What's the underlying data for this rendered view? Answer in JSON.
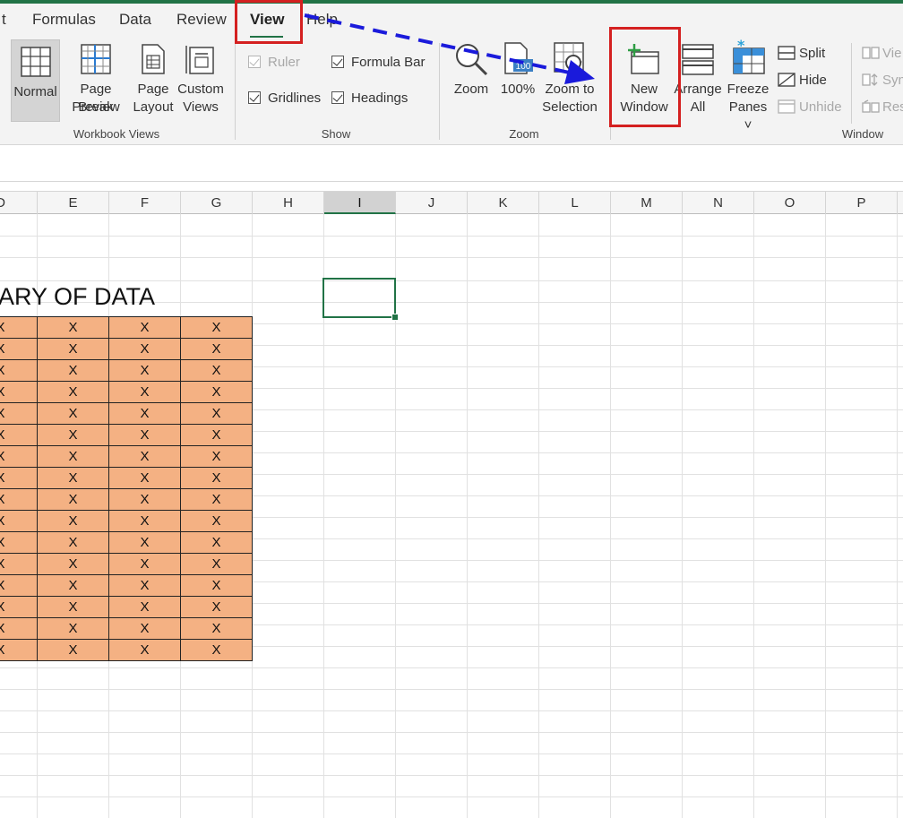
{
  "tabs": [
    {
      "label": "t"
    },
    {
      "label": "Formulas"
    },
    {
      "label": "Data"
    },
    {
      "label": "Review"
    },
    {
      "label": "View"
    },
    {
      "label": "Help"
    }
  ],
  "ribbon": {
    "workbook_views": {
      "group_label": "Workbook Views",
      "normal": [
        "Normal",
        ""
      ],
      "page_break": [
        "Page Break",
        "Preview"
      ],
      "page_layout": [
        "Page",
        "Layout"
      ],
      "custom_views": [
        "Custom",
        "Views"
      ]
    },
    "show": {
      "group_label": "Show",
      "ruler": "Ruler",
      "formula_bar": "Formula Bar",
      "gridlines": "Gridlines",
      "headings": "Headings"
    },
    "zoom": {
      "group_label": "Zoom",
      "zoom": "Zoom",
      "hundred": "100%",
      "hundred_icon_text": "100",
      "zoom_sel": [
        "Zoom to",
        "Selection"
      ]
    },
    "window": {
      "group_label": "Window",
      "new_window": [
        "New",
        "Window"
      ],
      "arrange_all": [
        "Arrange",
        "All"
      ],
      "freeze_panes": [
        "Freeze",
        "Panes ˅"
      ],
      "split": "Split",
      "hide": "Hide",
      "unhide": "Unhide",
      "view_side": "Vie",
      "sync": "Syn",
      "reset": "Res"
    }
  },
  "columns": [
    "D",
    "E",
    "F",
    "G",
    "H",
    "I",
    "J",
    "K",
    "L",
    "M",
    "N",
    "O",
    "P"
  ],
  "selected_column": "I",
  "sheet": {
    "title": "ARY OF DATA",
    "cell_mark": "X",
    "rows": [
      [
        "X",
        "X",
        "X",
        "X"
      ],
      [
        "X",
        "X",
        "X",
        "X"
      ],
      [
        "X",
        "X",
        "X",
        "X"
      ],
      [
        "X",
        "X",
        "X",
        "X"
      ],
      [
        "X",
        "X",
        "X",
        "X"
      ],
      [
        "X",
        "X",
        "X",
        "X"
      ],
      [
        "X",
        "X",
        "X",
        "X"
      ],
      [
        "X",
        "X",
        "X",
        "X"
      ],
      [
        "X",
        "X",
        "X",
        "X"
      ],
      [
        "X",
        "X",
        "X",
        "X"
      ],
      [
        "X",
        "X",
        "X",
        "X"
      ],
      [
        "X",
        "X",
        "X",
        "X"
      ],
      [
        "X",
        "X",
        "X",
        "X"
      ],
      [
        "X",
        "X",
        "X",
        "X"
      ],
      [
        "X",
        "X",
        "X",
        "X"
      ],
      [
        "X",
        "X",
        "X",
        "X"
      ]
    ],
    "fill_color": "#f4b183"
  },
  "annotation": {
    "highlight_color": "#d42020",
    "arrow_color": "#1a1adb"
  }
}
